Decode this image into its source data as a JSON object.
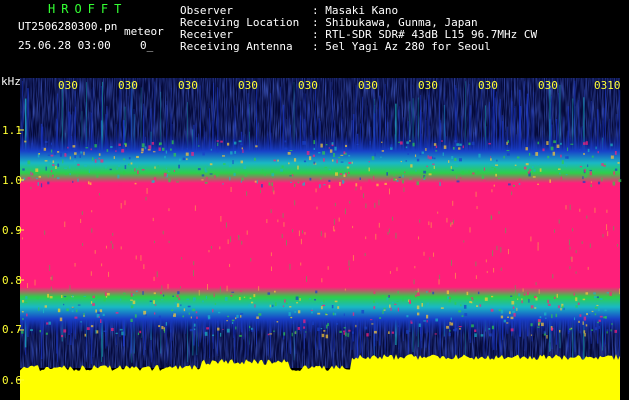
{
  "header": {
    "app_name": "HROFFT",
    "filename": "UT2506280300.pn",
    "mode": "meteor",
    "timestamp": "25.06.28 03:00",
    "count": "0_",
    "info_labels": [
      "Observer",
      "Receiving Location",
      "Receiver",
      "Receiving Antenna"
    ],
    "info_values": [
      ": Masaki Kano",
      ": Shibukawa, Gunma, Japan",
      ": RTL-SDR SDR# 43dB L15 96.7MHz CW",
      ": 5el Yagi Az 280 for Seoul"
    ]
  },
  "spectrogram": {
    "freq_unit": "kHz",
    "freq_ticks": [
      "1.1",
      "1.0",
      "0.9",
      "0.8",
      "0.7",
      "0.6"
    ],
    "time_ticks": [
      "030",
      "030",
      "030",
      "030",
      "030",
      "030",
      "030",
      "030",
      "030",
      "0310"
    ]
  },
  "colors": {
    "background": "#000000",
    "signal_core": "#ff1f7a",
    "noise_floor": "#0a1a8f",
    "amplitude_trace": "#ffff00",
    "tick_text": "#ffff33",
    "header_text": "#ffffff",
    "app_name_text": "#33ff33"
  }
}
